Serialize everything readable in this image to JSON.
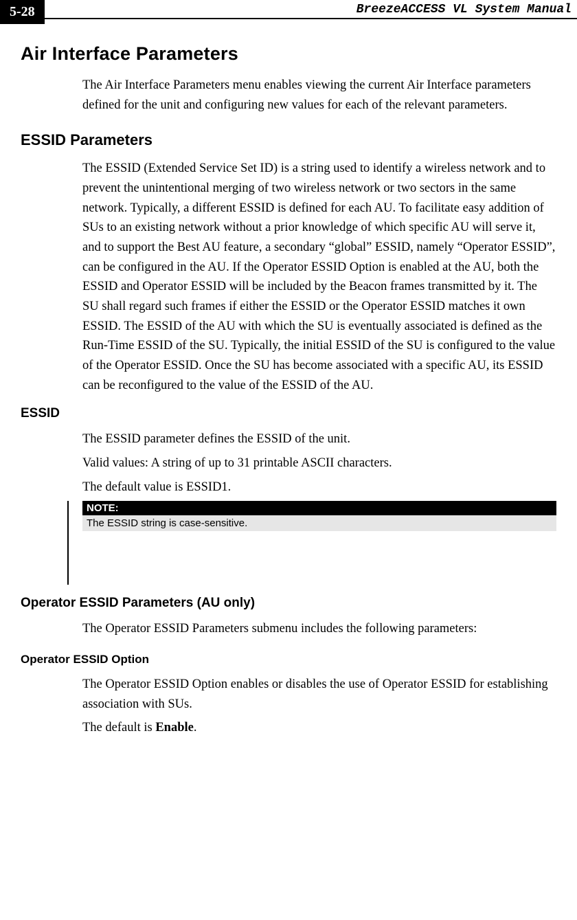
{
  "header": {
    "page_number": "5-28",
    "manual_title": "BreezeACCESS VL System Manual"
  },
  "sections": {
    "air_interface": {
      "title": "Air Interface Parameters",
      "p1": "The Air Interface Parameters menu enables viewing the current Air Interface parameters defined for the unit and configuring new values for each of the relevant parameters."
    },
    "essid_params": {
      "title": "ESSID Parameters",
      "p1": "The ESSID (Extended Service Set ID) is a string used to identify a wireless network and to prevent the unintentional merging of two wireless network or two sectors in the same network. Typically, a different ESSID is defined for each AU. To facilitate easy addition of SUs to an existing network without a prior knowledge of which specific AU will serve it, and to support the Best AU feature, a secondary “global” ESSID, namely “Operator ESSID”, can be configured in the AU. If the Operator ESSID Option is enabled at the AU, both the ESSID and Operator ESSID will be included by the Beacon frames transmitted by it. The SU shall regard such frames if either the ESSID or the Operator ESSID matches it own ESSID.  The ESSID of the AU with which the SU is eventually associated is defined as the Run-Time ESSID of the SU. Typically, the initial ESSID of the SU is configured to the value of the Operator ESSID. Once the SU has become associated with a specific AU, its ESSID can be reconfigured to the value of the ESSID of the AU."
    },
    "essid": {
      "title": "ESSID",
      "p1": "The ESSID parameter defines the ESSID of the unit.",
      "p2": "Valid values: A string of up to 31 printable ASCII characters.",
      "p3": "The default value is ESSID1.",
      "note_label": "NOTE:",
      "note_text": "The ESSID string is case-sensitive."
    },
    "operator_essid_params": {
      "title": "Operator ESSID Parameters (AU only)",
      "p1": "The Operator ESSID Parameters submenu includes the following parameters:"
    },
    "operator_essid_option": {
      "title": "Operator ESSID Option",
      "p1": "The Operator ESSID Option enables or disables the use of Operator ESSID for establishing association with SUs.",
      "p2_prefix": "The default is ",
      "p2_bold": "Enable",
      "p2_suffix": "."
    }
  }
}
